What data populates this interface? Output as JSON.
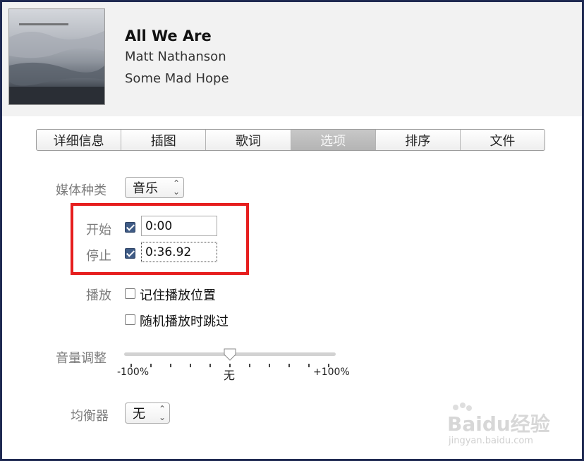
{
  "song": {
    "title": "All We Are",
    "artist": "Matt Nathanson",
    "album": "Some Mad Hope"
  },
  "tabs": [
    {
      "label": "详细信息",
      "active": false
    },
    {
      "label": "插图",
      "active": false
    },
    {
      "label": "歌词",
      "active": false
    },
    {
      "label": "选项",
      "active": true
    },
    {
      "label": "排序",
      "active": false
    },
    {
      "label": "文件",
      "active": false
    }
  ],
  "options": {
    "media_kind_label": "媒体种类",
    "media_kind_value": "音乐",
    "start_label": "开始",
    "start_checked": true,
    "start_value": "0:00",
    "stop_label": "停止",
    "stop_checked": true,
    "stop_value": "0:36.92",
    "playback_label": "播放",
    "remember_position_label": "记住播放位置",
    "remember_position_checked": false,
    "skip_shuffle_label": "随机播放时跳过",
    "skip_shuffle_checked": false,
    "volume_label": "音量调整",
    "volume_min_label": "-100%",
    "volume_mid_label": "无",
    "volume_max_label": "+100%",
    "volume_value_percent": 0,
    "equalizer_label": "均衡器",
    "equalizer_value": "无"
  },
  "icons": {
    "select_chevron": "chevron-updown-icon",
    "checkmark": "checkmark-icon"
  },
  "colors": {
    "highlight": "#e61e1e",
    "checkbox_checked": "#3f5b85",
    "frame_border": "#1f2a52"
  },
  "watermark": {
    "brand": "Baidu经验",
    "url": "jingyan.baidu.com"
  }
}
